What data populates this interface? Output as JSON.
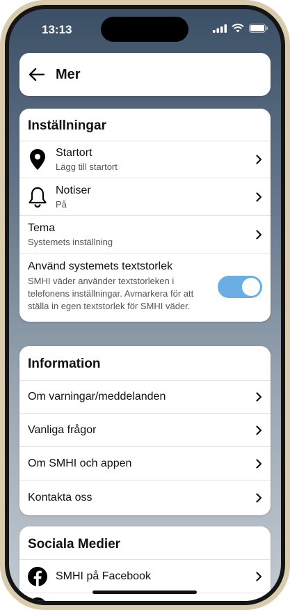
{
  "status": {
    "time": "13:13"
  },
  "header": {
    "title": "Mer"
  },
  "settings": {
    "title": "Inställningar",
    "items": [
      {
        "label": "Startort",
        "sub": "Lägg till startort"
      },
      {
        "label": "Notiser",
        "sub": "På"
      },
      {
        "label": "Tema",
        "sub": "Systemets inställning"
      }
    ],
    "textsize": {
      "label": "Använd systemets textstorlek",
      "desc": "SMHI väder använder textstorleken i telefonens inställningar. Avmarkera för att ställa in egen textstorlek för SMHI väder.",
      "enabled": true
    }
  },
  "info": {
    "title": "Information",
    "items": [
      {
        "label": "Om varningar/meddelanden"
      },
      {
        "label": "Vanliga frågor"
      },
      {
        "label": "Om SMHI och appen"
      },
      {
        "label": "Kontakta oss"
      }
    ]
  },
  "social": {
    "title": "Sociala Medier",
    "items": [
      {
        "label": "SMHI på Facebook"
      }
    ]
  },
  "colors": {
    "toggle_on": "#6aaee3"
  }
}
